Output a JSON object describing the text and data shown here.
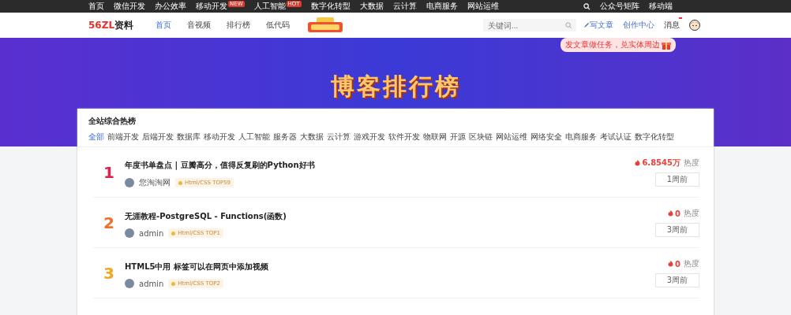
{
  "top_bar": {
    "links": [
      {
        "label": "首页"
      },
      {
        "label": "微信开发"
      },
      {
        "label": "办公效率"
      },
      {
        "label": "移动开发",
        "badge": "NEW"
      },
      {
        "label": "人工智能",
        "badge": "HOT"
      },
      {
        "label": "数字化转型"
      },
      {
        "label": "大数据"
      },
      {
        "label": "云计算"
      },
      {
        "label": "电商服务"
      },
      {
        "label": "网站运维"
      }
    ],
    "right_links": [
      "公众号矩阵",
      "移动端"
    ]
  },
  "header": {
    "logo_mark": "56ZL",
    "logo_text": "资料",
    "nav": [
      {
        "label": "首页",
        "selected": true
      },
      {
        "label": "音视频",
        "selected": false
      },
      {
        "label": "排行榜",
        "selected": false
      },
      {
        "label": "低代码",
        "selected": false
      }
    ],
    "search": {
      "placeholder": "关键词..."
    },
    "write": "写文章",
    "creator": "创作中心",
    "messages": "消息",
    "promo": "发文章做任务，兑实体周边"
  },
  "banner": {
    "title": "博客排行榜"
  },
  "board": {
    "title": "全站综合热榜",
    "categories": [
      {
        "label": "全部",
        "selected": true
      },
      {
        "label": "前端开发",
        "selected": false
      },
      {
        "label": "后端开发",
        "selected": false
      },
      {
        "label": "数据库",
        "selected": false
      },
      {
        "label": "移动开发",
        "selected": false
      },
      {
        "label": "人工智能",
        "selected": false
      },
      {
        "label": "服务器",
        "selected": false
      },
      {
        "label": "大数据",
        "selected": false
      },
      {
        "label": "云计算",
        "selected": false
      },
      {
        "label": "游戏开发",
        "selected": false
      },
      {
        "label": "软件开发",
        "selected": false
      },
      {
        "label": "物联网",
        "selected": false
      },
      {
        "label": "开源",
        "selected": false
      },
      {
        "label": "区块链",
        "selected": false
      },
      {
        "label": "网站运维",
        "selected": false
      },
      {
        "label": "网络安全",
        "selected": false
      },
      {
        "label": "电商服务",
        "selected": false
      },
      {
        "label": "考试认证",
        "selected": false
      },
      {
        "label": "数字化转型",
        "selected": false
      }
    ],
    "items": [
      {
        "rank": "1",
        "color": "#e0234e",
        "title": "年度书单盘点 | 豆瓣高分，值得反复刷的Python好书",
        "author": "您淘淘网",
        "tag": "Html/CSS TOP59",
        "heat": "6.8545万",
        "heat_label": "热度",
        "time": "1周前"
      },
      {
        "rank": "2",
        "color": "#f0702c",
        "title": "无涯教程-PostgreSQL - Functions(函数)",
        "author": "admin",
        "tag": "Html/CSS TOP1",
        "heat": "0",
        "heat_label": "热度",
        "time": "3周前"
      },
      {
        "rank": "3",
        "color": "#f2a623",
        "title": "HTML5中用 标签可以在网页中添加视频",
        "author": "admin",
        "tag": "Html/CSS TOP2",
        "heat": "0",
        "heat_label": "热度",
        "time": "3周前"
      }
    ]
  }
}
